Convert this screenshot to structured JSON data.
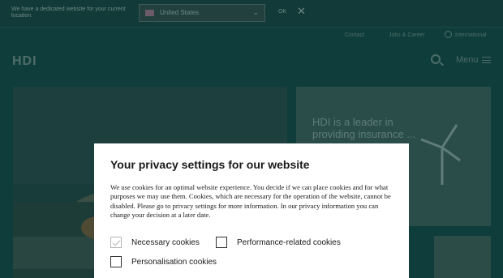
{
  "notice": {
    "text": "We have a dedicated website for your current location.",
    "country": "United States",
    "ok_label": "OK",
    "close_glyph": "✕"
  },
  "header": {
    "top_links": [
      "Contact",
      "Jobs & Career",
      "International"
    ],
    "logo": "HDI",
    "menu_label": "Menu"
  },
  "info_card": {
    "text": "HDI is a leader in providing insurance ... sector"
  },
  "modal": {
    "title": "Your privacy settings for our website",
    "body": "We use cookies for an optimal website experience. You decide if we can place cookies and for what purposes we may use them. Cookies, which are necessary for the operation of the website, cannot be disabled. Please go to privacy settings for more information. In our privacy information you can change your decision at a later date.",
    "options": [
      {
        "label": "Necessary cookies",
        "checked": true,
        "disabled": true
      },
      {
        "label": "Performance-related cookies",
        "checked": false
      },
      {
        "label": "Personalisation cookies",
        "checked": false
      }
    ]
  },
  "icons": [
    "flag-icon",
    "chevron-down-icon",
    "close-icon",
    "globe-icon",
    "search-icon",
    "hamburger-icon",
    "wind-turbine-icon",
    "checkmark-icon"
  ]
}
